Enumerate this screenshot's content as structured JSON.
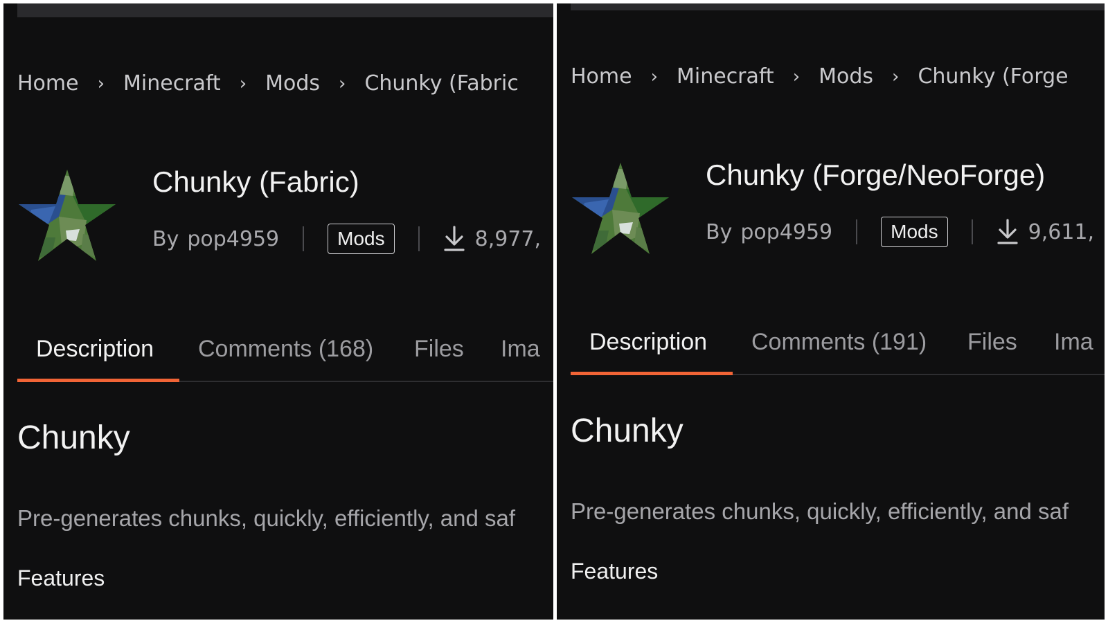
{
  "panels": [
    {
      "breadcrumb": [
        "Home",
        "Minecraft",
        "Mods",
        "Chunky (Fabric"
      ],
      "breadcrumb_separator": "›",
      "icon": "star-world-map-icon",
      "title": "Chunky (Fabric)",
      "by_label": "By",
      "author": "pop4959",
      "category_tag": "Mods",
      "download_icon": "download-icon",
      "downloads": "8,977,",
      "tabs": [
        "Description",
        "Comments (168)",
        "Files",
        "Ima"
      ],
      "active_tab": "Description",
      "section_heading": "Chunky",
      "summary": "Pre-generates chunks, quickly, efficiently, and saf",
      "features_heading": "Features"
    },
    {
      "breadcrumb": [
        "Home",
        "Minecraft",
        "Mods",
        "Chunky (Forge"
      ],
      "breadcrumb_separator": "›",
      "icon": "star-world-map-icon",
      "title": "Chunky (Forge/NeoForge)",
      "by_label": "By",
      "author": "pop4959",
      "category_tag": "Mods",
      "download_icon": "download-icon",
      "downloads": "9,611,",
      "tabs": [
        "Description",
        "Comments (191)",
        "Files",
        "Ima"
      ],
      "active_tab": "Description",
      "section_heading": "Chunky",
      "summary": "Pre-generates chunks, quickly, efficiently, and saf",
      "features_heading": "Features"
    }
  ],
  "colors": {
    "background": "#0f0f10",
    "accent": "#f16436",
    "text_primary": "#f2f2f2",
    "text_secondary": "#a9a9ad"
  }
}
